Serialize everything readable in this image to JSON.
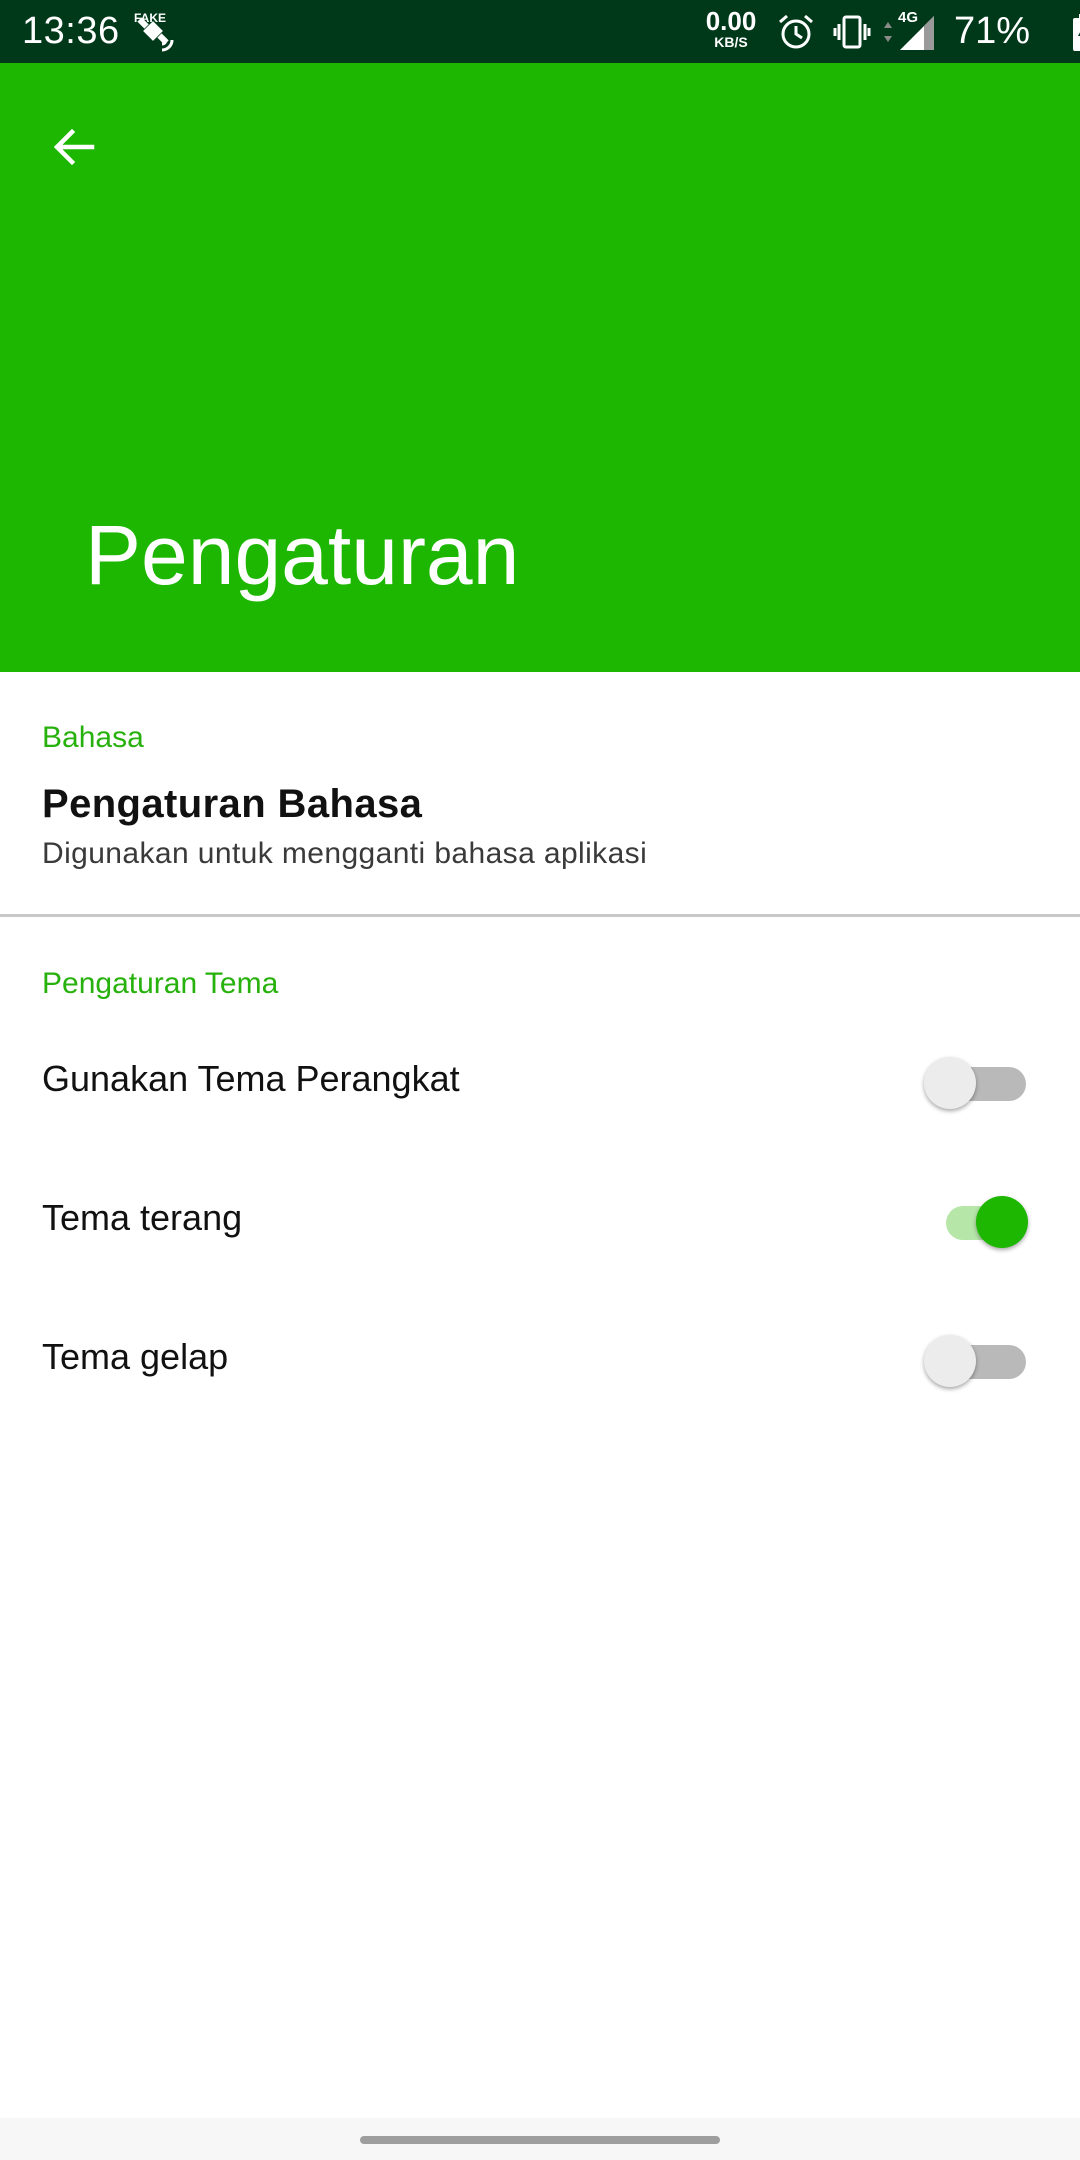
{
  "status_bar": {
    "time": "13:36",
    "gps_label": "FAKE",
    "net_speed_value": "0.00",
    "net_speed_unit": "KB/S",
    "network_type": "4G",
    "battery_percent": "71%",
    "icons": [
      "fake-gps-icon",
      "alarm-icon",
      "vibrate-icon",
      "signal-icon",
      "battery-charging-icon"
    ]
  },
  "app_bar": {
    "title": "Pengaturan",
    "back_icon": "arrow-left-icon",
    "color": "#1db701"
  },
  "language_section": {
    "header": "Bahasa",
    "pref_title": "Pengaturan Bahasa",
    "pref_summary": "Digunakan untuk mengganti bahasa aplikasi"
  },
  "theme_section": {
    "header": "Pengaturan Tema",
    "switches": [
      {
        "label": "Gunakan Tema Perangkat",
        "checked": false
      },
      {
        "label": "Tema terang",
        "checked": true
      },
      {
        "label": "Tema gelap",
        "checked": false
      }
    ]
  },
  "colors": {
    "accent": "#27b10c",
    "status_bar": "#00391a",
    "switch_on_thumb": "#1db701",
    "switch_on_track": "#b6e6a8",
    "switch_off_track": "#b9b9b9"
  }
}
